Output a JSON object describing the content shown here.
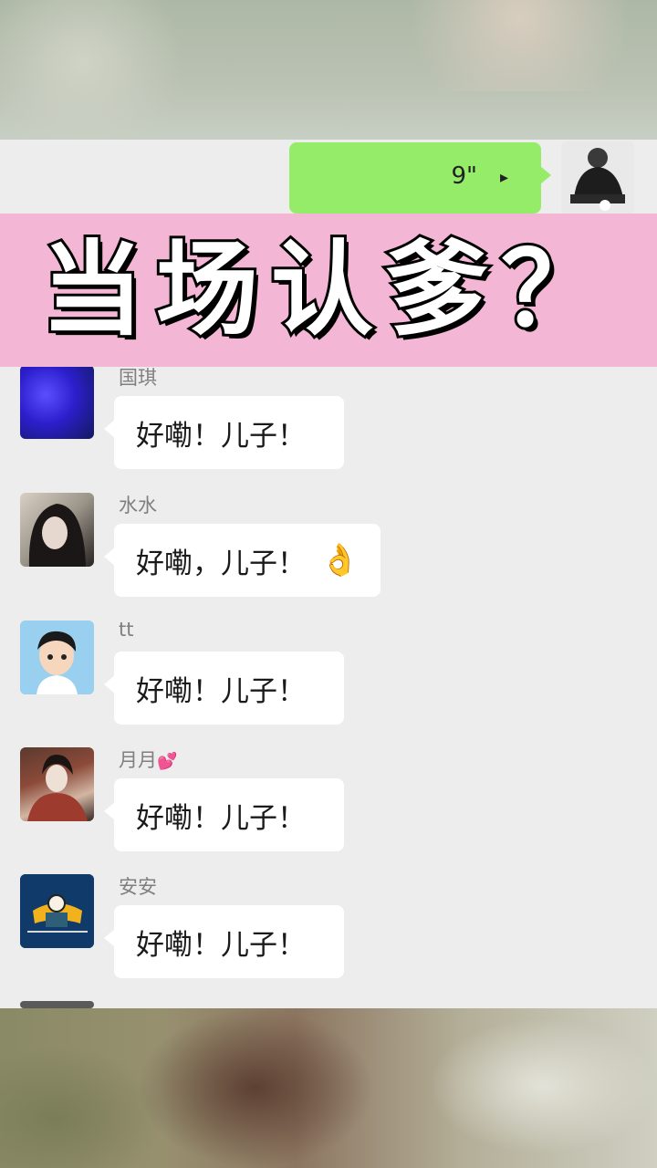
{
  "voice_message": {
    "duration": "9\"",
    "play_icon": "voice-play-icon",
    "bubble_color": "#95ec69"
  },
  "banner": {
    "text": "当场认爹？",
    "background": "#f4b6d5"
  },
  "messages": [
    {
      "sender": "国琪",
      "text": "好嘞！儿子！"
    },
    {
      "sender": "水水",
      "text": "好嘞，儿子！",
      "emoji": "👌"
    },
    {
      "sender": "tt",
      "text": "好嘞！儿子！"
    },
    {
      "sender": "月月",
      "sender_suffix": "💕",
      "text": "好嘞！儿子！"
    },
    {
      "sender": "安安",
      "text": "好嘞！儿子！"
    }
  ]
}
